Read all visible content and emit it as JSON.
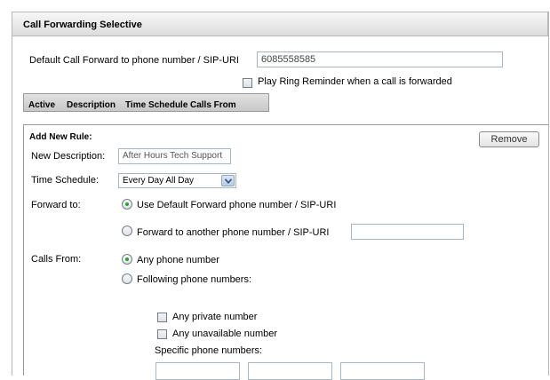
{
  "header": {
    "title": "Call Forwarding Selective"
  },
  "default_forward": {
    "label": "Default Call Forward to phone number / SIP-URI",
    "value": "6085558585"
  },
  "ring_reminder": {
    "label": "Play Ring Reminder when a call is forwarded",
    "checked": false
  },
  "rules_table": {
    "columns": [
      "Active",
      "Description",
      "Time Schedule",
      "Calls From"
    ]
  },
  "new_rule": {
    "title": "Add New Rule:",
    "remove_label": "Remove",
    "description_label": "New Description:",
    "description_value": "After Hours Tech Support",
    "schedule_label": "Time Schedule:",
    "schedule_value": "Every Day All Day",
    "forward_label": "Forward to:",
    "forward_options": [
      "Use Default Forward phone number / SIP-URI",
      "Forward to another phone number / SIP-URI"
    ],
    "forward_selected": 0,
    "forward_other_value": "",
    "calls_from_label": "Calls From:",
    "calls_from_options": [
      "Any phone number",
      "Following phone numbers:"
    ],
    "calls_from_selected": 0,
    "any_private_label": "Any private number",
    "any_unavailable_label": "Any unavailable number",
    "specific_label": "Specific phone numbers:"
  },
  "colors": {
    "radio_selected": "#29a329",
    "input_border": "#a4b6c8"
  }
}
